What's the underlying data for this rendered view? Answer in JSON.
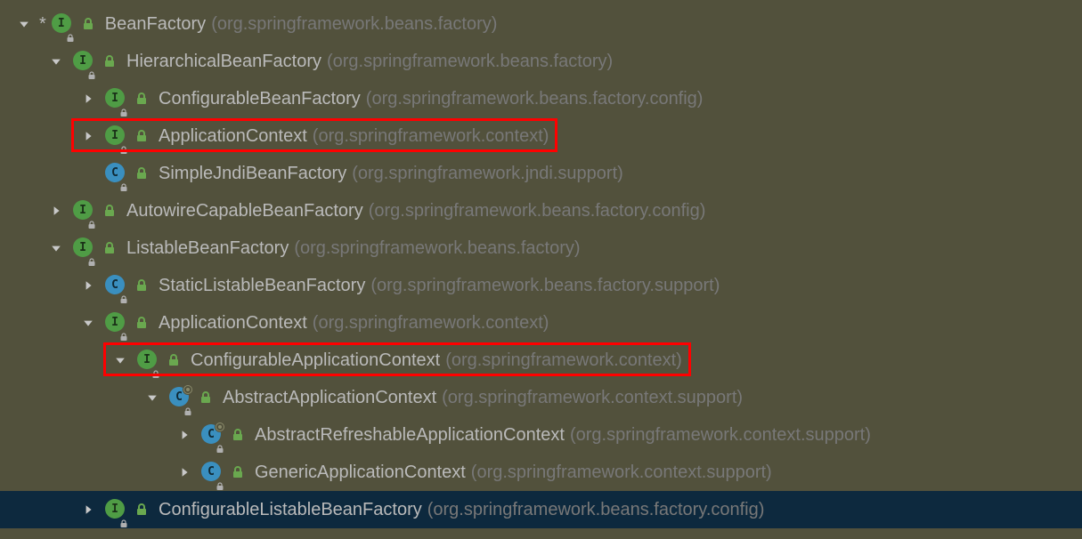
{
  "asterisk": "*",
  "tree": [
    {
      "indent": 0,
      "arrow": "down",
      "asterisk": true,
      "kind": "interface",
      "name": "BeanFactory",
      "pkg": "(org.springframework.beans.factory)"
    },
    {
      "indent": 1,
      "arrow": "down",
      "kind": "interface",
      "name": "HierarchicalBeanFactory",
      "pkg": "(org.springframework.beans.factory)"
    },
    {
      "indent": 2,
      "arrow": "right",
      "kind": "interface",
      "name": "ConfigurableBeanFactory",
      "pkg": "(org.springframework.beans.factory.config)"
    },
    {
      "indent": 2,
      "arrow": "right",
      "kind": "interface",
      "name": "ApplicationContext",
      "pkg": "(org.springframework.context)",
      "red": true
    },
    {
      "indent": 2,
      "arrow": "none",
      "kind": "class",
      "name": "SimpleJndiBeanFactory",
      "pkg": "(org.springframework.jndi.support)"
    },
    {
      "indent": 1,
      "arrow": "right",
      "kind": "interface",
      "name": "AutowireCapableBeanFactory",
      "pkg": "(org.springframework.beans.factory.config)"
    },
    {
      "indent": 1,
      "arrow": "down",
      "kind": "interface",
      "name": "ListableBeanFactory",
      "pkg": "(org.springframework.beans.factory)"
    },
    {
      "indent": 2,
      "arrow": "right",
      "kind": "class",
      "name": "StaticListableBeanFactory",
      "pkg": "(org.springframework.beans.factory.support)"
    },
    {
      "indent": 2,
      "arrow": "down",
      "kind": "interface",
      "name": "ApplicationContext",
      "pkg": "(org.springframework.context)"
    },
    {
      "indent": 3,
      "arrow": "down",
      "kind": "interface",
      "name": "ConfigurableApplicationContext",
      "pkg": "(org.springframework.context)",
      "red": true
    },
    {
      "indent": 4,
      "arrow": "down",
      "kind": "class",
      "abstract": true,
      "name": "AbstractApplicationContext",
      "pkg": "(org.springframework.context.support)"
    },
    {
      "indent": 5,
      "arrow": "right",
      "kind": "class",
      "abstract": true,
      "name": "AbstractRefreshableApplicationContext",
      "pkg": "(org.springframework.context.support)"
    },
    {
      "indent": 5,
      "arrow": "right",
      "kind": "class",
      "name": "GenericApplicationContext",
      "pkg": "(org.springframework.context.support)"
    },
    {
      "indent": 2,
      "arrow": "right",
      "kind": "interface",
      "name": "ConfigurableListableBeanFactory",
      "pkg": "(org.springframework.beans.factory.config)",
      "selected": true
    }
  ],
  "icon_letters": {
    "interface": "I",
    "class": "C"
  }
}
